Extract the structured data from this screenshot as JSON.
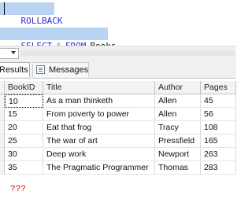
{
  "editor": {
    "line1": {
      "text": "ROLLBACK"
    },
    "line2": {
      "kw1": "SELECT",
      "op": "*",
      "kw2": "FROM",
      "table": "Books"
    },
    "colors": {
      "keyword": "#2b2bd8",
      "selection": "#b9d4f3"
    }
  },
  "results_tabs": {
    "results_label": "Results",
    "messages_label": "Messages",
    "messages_icon": "messages-icon"
  },
  "grid": {
    "columns": [
      "BookID",
      "Title",
      "Author",
      "Pages"
    ],
    "rows": [
      [
        "10",
        "As a man thinketh",
        "Allen",
        "45"
      ],
      [
        "15",
        "From poverty to power",
        "Allen",
        "56"
      ],
      [
        "20",
        "Eat that frog",
        "Tracy",
        "108"
      ],
      [
        "25",
        "The war of art",
        "Pressfield",
        "165"
      ],
      [
        "30",
        "Deep work",
        "Newport",
        "263"
      ],
      [
        "35",
        "The Pragmatic Programmer",
        "Thomas",
        "283"
      ]
    ],
    "annotation": "???",
    "annotation_color": "#e01010"
  }
}
